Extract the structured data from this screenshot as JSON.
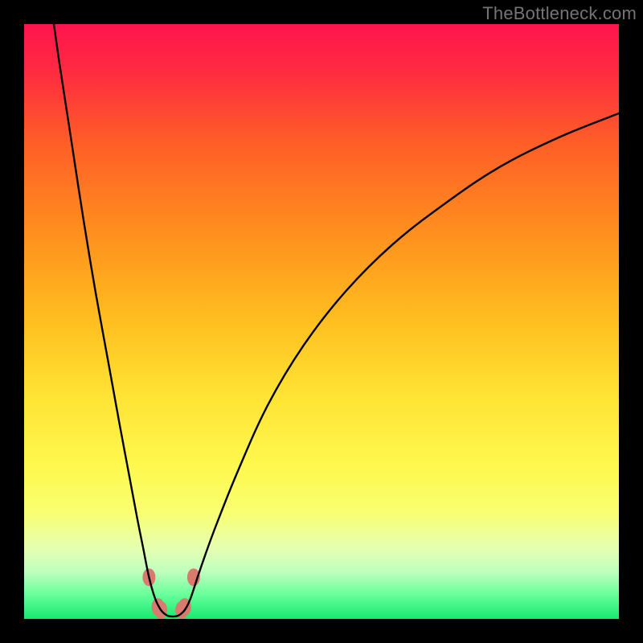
{
  "watermark": "TheBottleneck.com",
  "chart_data": {
    "type": "line",
    "title": "",
    "xlabel": "",
    "ylabel": "",
    "xlim": [
      0,
      100
    ],
    "ylim": [
      0,
      100
    ],
    "background_gradient": {
      "stops": [
        {
          "offset": 0.0,
          "color": "#ff144e"
        },
        {
          "offset": 0.08,
          "color": "#ff2b40"
        },
        {
          "offset": 0.2,
          "color": "#ff5e27"
        },
        {
          "offset": 0.35,
          "color": "#ff8f1e"
        },
        {
          "offset": 0.5,
          "color": "#ffbf1f"
        },
        {
          "offset": 0.62,
          "color": "#ffe233"
        },
        {
          "offset": 0.74,
          "color": "#fff84d"
        },
        {
          "offset": 0.82,
          "color": "#f9ff70"
        },
        {
          "offset": 0.88,
          "color": "#e6ffb0"
        },
        {
          "offset": 0.92,
          "color": "#c0ffc0"
        },
        {
          "offset": 0.96,
          "color": "#66ff99"
        },
        {
          "offset": 1.0,
          "color": "#17e96f"
        }
      ]
    },
    "series": [
      {
        "name": "bottleneck-curve",
        "stroke": "#000000",
        "points": [
          {
            "x": 5.0,
            "y": 100.0
          },
          {
            "x": 6.0,
            "y": 93.0
          },
          {
            "x": 8.0,
            "y": 80.0
          },
          {
            "x": 10.0,
            "y": 67.0
          },
          {
            "x": 12.0,
            "y": 55.0
          },
          {
            "x": 14.0,
            "y": 44.0
          },
          {
            "x": 16.0,
            "y": 33.0
          },
          {
            "x": 17.5,
            "y": 25.0
          },
          {
            "x": 19.0,
            "y": 17.0
          },
          {
            "x": 20.0,
            "y": 12.0
          },
          {
            "x": 21.0,
            "y": 7.0
          },
          {
            "x": 22.0,
            "y": 3.5
          },
          {
            "x": 23.0,
            "y": 1.5
          },
          {
            "x": 24.0,
            "y": 0.6
          },
          {
            "x": 25.0,
            "y": 0.4
          },
          {
            "x": 26.0,
            "y": 0.6
          },
          {
            "x": 27.0,
            "y": 1.5
          },
          {
            "x": 28.0,
            "y": 3.5
          },
          {
            "x": 29.5,
            "y": 8.0
          },
          {
            "x": 32.0,
            "y": 15.0
          },
          {
            "x": 36.0,
            "y": 25.0
          },
          {
            "x": 41.0,
            "y": 36.0
          },
          {
            "x": 47.0,
            "y": 46.0
          },
          {
            "x": 54.0,
            "y": 55.0
          },
          {
            "x": 62.0,
            "y": 63.0
          },
          {
            "x": 71.0,
            "y": 70.0
          },
          {
            "x": 80.0,
            "y": 76.0
          },
          {
            "x": 90.0,
            "y": 81.0
          },
          {
            "x": 100.0,
            "y": 85.0
          }
        ]
      }
    ],
    "markers": [
      {
        "x": 21.0,
        "y": 7.0
      },
      {
        "x": 22.5,
        "y": 2.0
      },
      {
        "x": 23.0,
        "y": 1.5
      },
      {
        "x": 26.5,
        "y": 1.5
      },
      {
        "x": 27.0,
        "y": 2.0
      },
      {
        "x": 28.5,
        "y": 7.0
      }
    ],
    "marker_style": {
      "fill": "#d87a6d",
      "rx": 8,
      "ry": 11
    }
  }
}
